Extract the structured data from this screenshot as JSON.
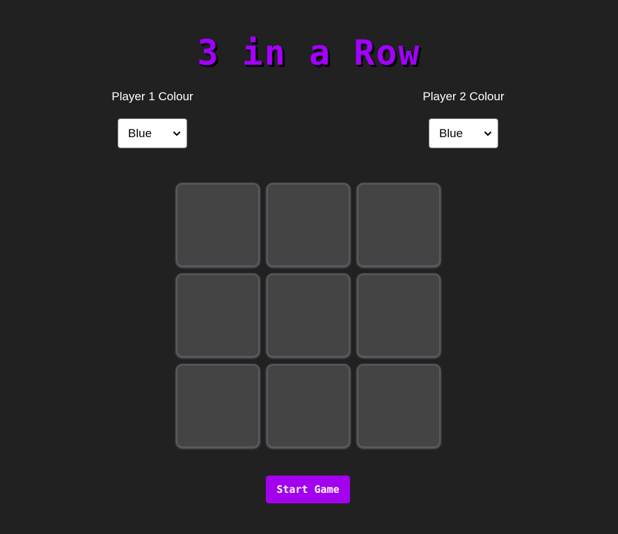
{
  "title": "3 in a Row",
  "colors": {
    "background": "#212121",
    "accent": "#a300ff",
    "cell": "#444444",
    "button": "#a300ee"
  },
  "player1": {
    "label": "Player 1 Colour",
    "selected_colour": "Blue"
  },
  "player2": {
    "label": "Player 2 Colour",
    "selected_colour": "Blue"
  },
  "board": {
    "rows": 3,
    "cols": 3,
    "cells": [
      "",
      "",
      "",
      "",
      "",
      "",
      "",
      "",
      ""
    ]
  },
  "start_button_label": "Start Game",
  "icons": {
    "dropdown": "chevron-down-icon"
  }
}
